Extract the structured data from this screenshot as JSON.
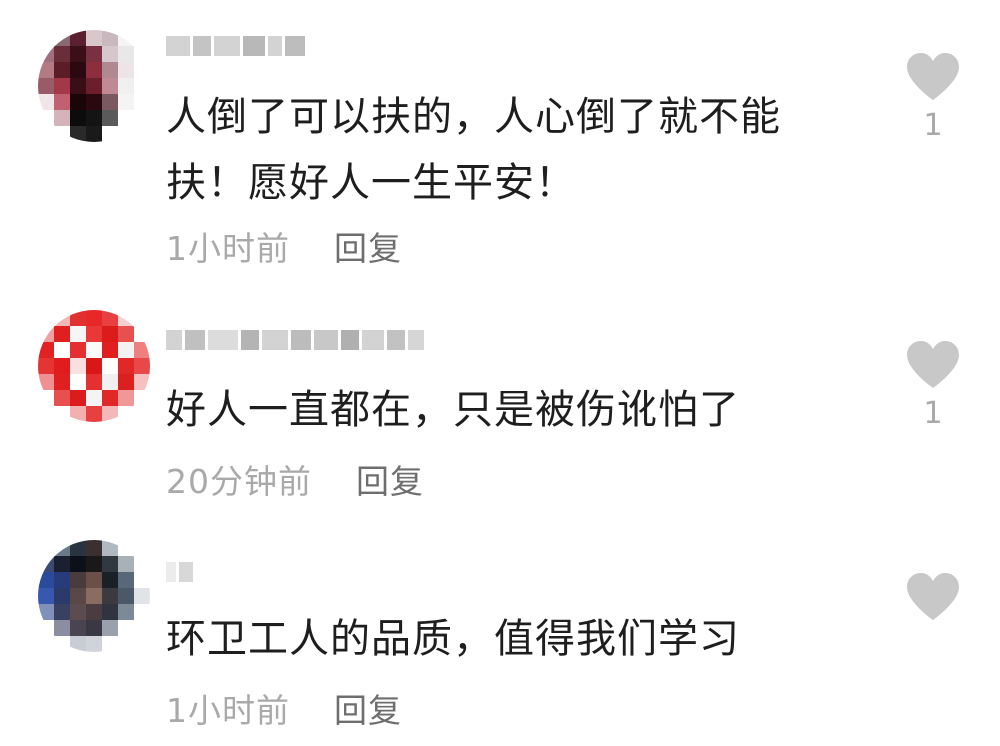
{
  "comments": [
    {
      "text": "人倒了可以扶的，人心倒了就不能扶！愿好人一生平安！",
      "time": "1小时前",
      "reply_label": "回复",
      "likes": "1"
    },
    {
      "text": "好人一直都在，只是被伤讹怕了",
      "time": "20分钟前",
      "reply_label": "回复",
      "likes": "1"
    },
    {
      "text": "环卫工人的品质，值得我们学习",
      "time": "1小时前",
      "reply_label": "回复",
      "likes": ""
    }
  ],
  "colors": {
    "text": "#1e1e1e",
    "meta": "#a9a9a9",
    "reply": "#6e6e6e",
    "heart": "#c8c8c8"
  },
  "icons": {
    "like": "heart-icon"
  }
}
